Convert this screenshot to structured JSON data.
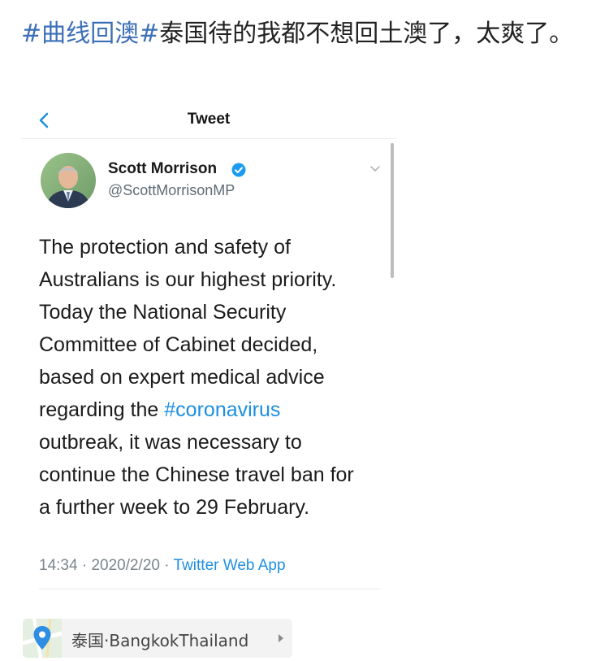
{
  "post": {
    "hashtag": "#曲线回澳#",
    "text": "泰国待的我都不想回土澳了，太爽了。"
  },
  "tweet_screenshot": {
    "header_title": "Tweet",
    "back_icon": "chevron-left-icon",
    "author": {
      "name": "Scott Morrison",
      "handle": "@ScottMorrisonMP",
      "verified": true
    },
    "body_lines": [
      "The protection and safety of",
      "Australians is our highest priority.",
      "Today the National Security",
      "Committee of Cabinet decided,",
      "based on expert medical advice",
      "regarding the ",
      "outbreak, it was necessary to",
      "continue the Chinese travel ban for",
      "a further week to 29 February."
    ],
    "hashtag_link": "#coronavirus",
    "meta": {
      "time": "14:34",
      "date": "2020/2/20",
      "source": "Twitter Web App",
      "separator": " · "
    }
  },
  "location": {
    "label": "泰国·BangkokThailand",
    "icon": "location-pin-icon"
  },
  "colors": {
    "hashtag_weibo": "#3b6fb6",
    "twitter_blue": "#1d8fe0",
    "verified": "#1d9bf0"
  }
}
